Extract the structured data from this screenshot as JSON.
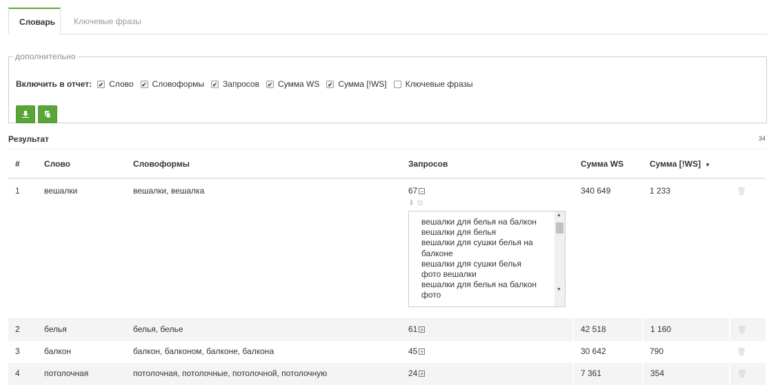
{
  "tabs": [
    {
      "label": "Словарь",
      "active": true
    },
    {
      "label": "Ключевые фразы",
      "active": false
    }
  ],
  "extra": {
    "legend": "дополнительно",
    "include_label": "Включить в отчет:",
    "options": [
      {
        "label": "Слово",
        "checked": true
      },
      {
        "label": "Словоформы",
        "checked": true
      },
      {
        "label": "Запросов",
        "checked": true
      },
      {
        "label": "Сумма WS",
        "checked": true
      },
      {
        "label": "Сумма [!WS]",
        "checked": true
      },
      {
        "label": "Ключевые фразы",
        "checked": false
      }
    ],
    "buttons": [
      {
        "icon": "download-icon"
      },
      {
        "icon": "copy-icon"
      }
    ]
  },
  "result": {
    "title": "Результат",
    "count": "34"
  },
  "table": {
    "headers": [
      "#",
      "Слово",
      "Словоформы",
      "Запросов",
      "Сумма WS",
      "Сумма [!WS]"
    ],
    "sorted_column": "Сумма [!WS]",
    "rows": [
      {
        "n": "1",
        "word": "вешалки",
        "forms": "вешалки, вешалка",
        "queries": "67",
        "expanded": true,
        "ws": "340 649",
        "ws_excl": "1 233"
      },
      {
        "n": "2",
        "word": "белья",
        "forms": "белья, белье",
        "queries": "61",
        "expanded": false,
        "ws": "42 518",
        "ws_excl": "1 160"
      },
      {
        "n": "3",
        "word": "балкон",
        "forms": "балкон, балконом, балконе, балкона",
        "queries": "45",
        "expanded": false,
        "ws": "30 642",
        "ws_excl": "790"
      },
      {
        "n": "4",
        "word": "потолочная",
        "forms": "потолочная, потолочные, потолочной, потолочную",
        "queries": "24",
        "expanded": false,
        "ws": "7 361",
        "ws_excl": "354"
      }
    ],
    "phrases": "вешалки для белья на балкон\nвешалки для белья\nвешалки для сушки белья на балконе\nвешалки для сушки белья\nфото вешалки\nвешалки для белья на балкон фото"
  }
}
